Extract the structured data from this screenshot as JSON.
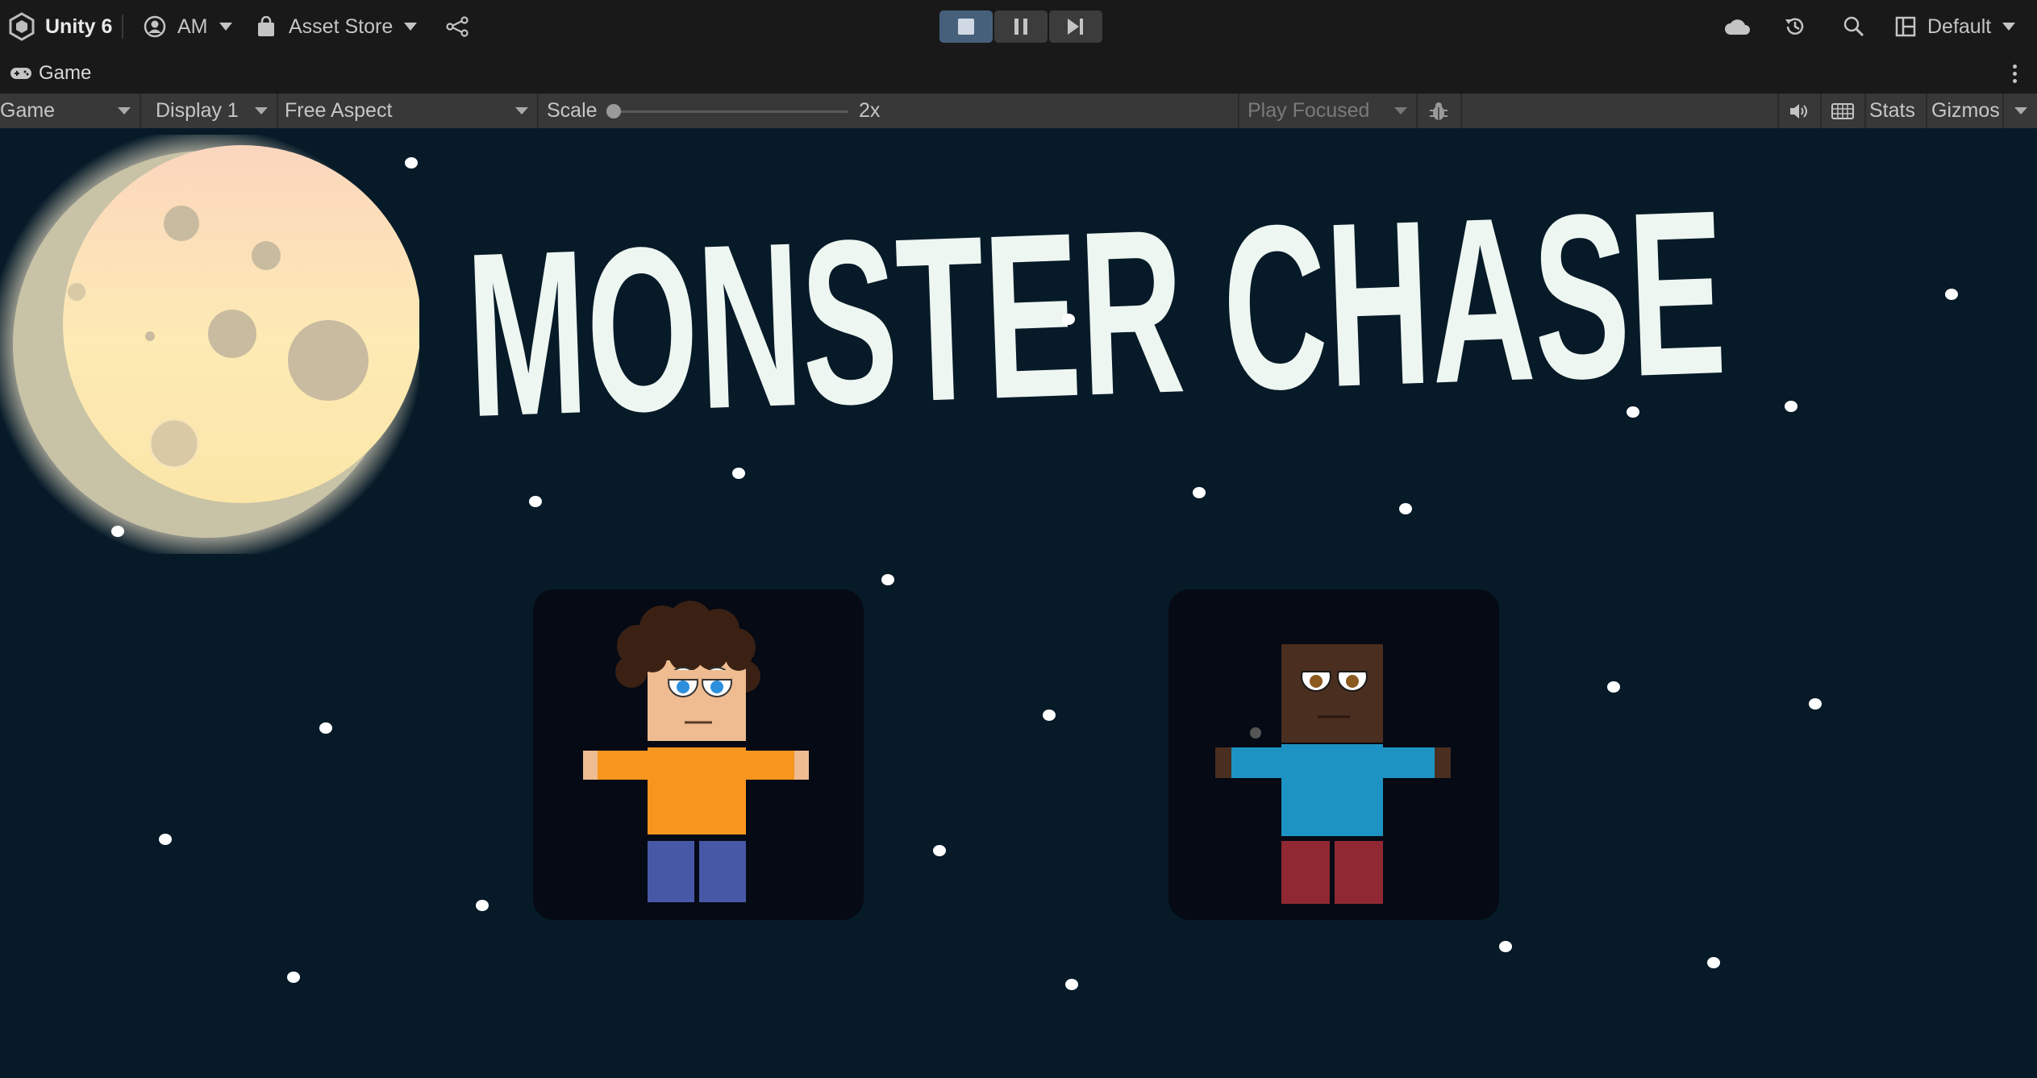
{
  "topbar": {
    "app_title": "Unity 6",
    "account_label": "AM",
    "asset_store_label": "Asset Store",
    "layout_label": "Default",
    "icons": [
      "unity-logo-icon",
      "account-icon",
      "asset-store-icon",
      "version-control-icon",
      "play-icon",
      "pause-icon",
      "step-icon",
      "cloud-icon",
      "history-icon",
      "search-icon",
      "layout-icon"
    ]
  },
  "tab": {
    "label": "Game",
    "icon": "gamepad-icon"
  },
  "toolbar": {
    "view_mode": "Game",
    "display": "Display 1",
    "aspect": "Free Aspect",
    "scale_label": "Scale",
    "scale_value": "2x",
    "play_mode": "Play Focused",
    "stats_label": "Stats",
    "gizmos_label": "Gizmos"
  },
  "game": {
    "title": "MONSTER CHASE",
    "background_color": "#061a28",
    "title_color": "#eef6f1",
    "characters": [
      {
        "name": "player-1",
        "shirt": "#f7961f",
        "pants": "#4658a6",
        "skin": "#eebc90"
      },
      {
        "name": "player-2",
        "shirt": "#1d93c4",
        "pants": "#8f2832",
        "skin": "#4a2e20"
      }
    ]
  },
  "colors": {
    "accent": "#46607c",
    "toolbar_bg": "#383838",
    "topbar_bg": "#191919"
  }
}
